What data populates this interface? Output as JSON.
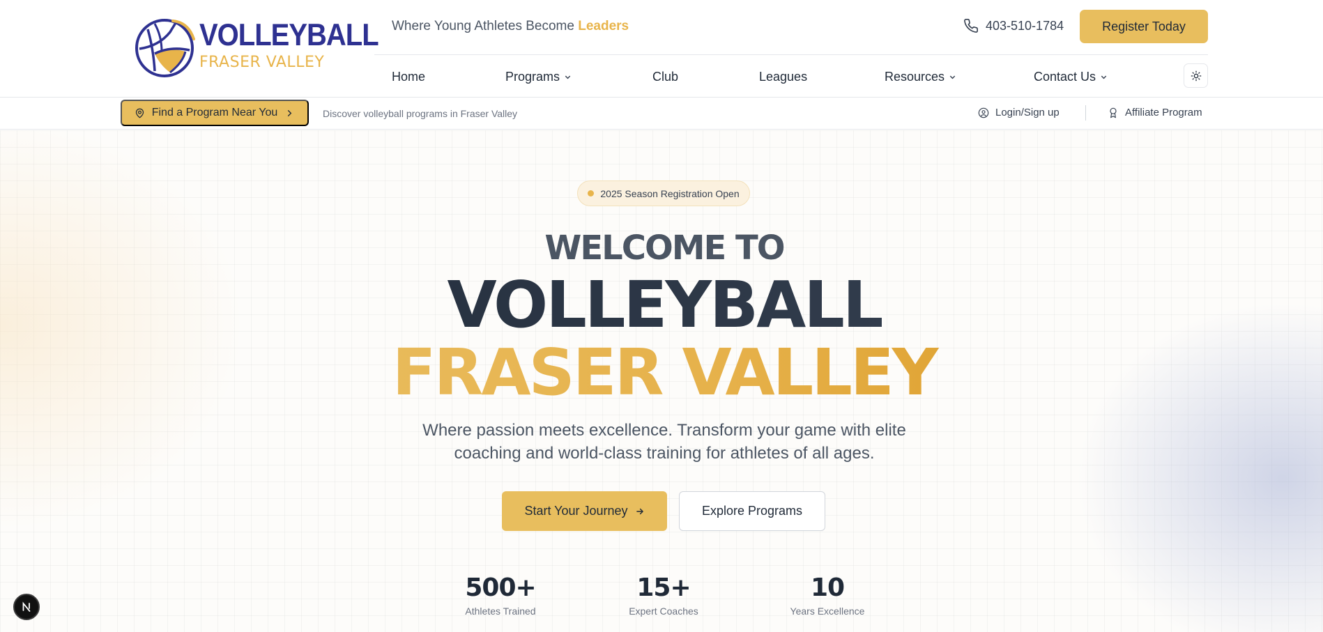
{
  "brand": {
    "line1": "VOLLEYBALL",
    "line2": "FRASER VALLEY",
    "primary_color": "#2e3191",
    "accent_color": "#e8b44a"
  },
  "header": {
    "tagline_prefix": "Where Young Athletes Become ",
    "tagline_accent": "Leaders",
    "phone": "403-510-1784",
    "register_label": "Register Today"
  },
  "nav": {
    "items": [
      {
        "label": "Home",
        "has_dropdown": false
      },
      {
        "label": "Programs",
        "has_dropdown": true
      },
      {
        "label": "Club",
        "has_dropdown": false
      },
      {
        "label": "Leagues",
        "has_dropdown": false
      },
      {
        "label": "Resources",
        "has_dropdown": true
      },
      {
        "label": "Contact Us",
        "has_dropdown": true
      }
    ],
    "theme_toggle_icon": "sun-icon"
  },
  "subbar": {
    "find_label": "Find a Program Near You",
    "description": "Discover volleyball programs in Fraser Valley",
    "login_label": "Login/Sign up",
    "affiliate_label": "Affiliate Program"
  },
  "hero": {
    "badge": "2025 Season Registration Open",
    "welcome": "WELCOME TO",
    "title_main": "VOLLEYBALL",
    "title_accent": "FRASER VALLEY",
    "subtitle": "Where passion meets excellence. Transform your game with elite coaching and world-class training for athletes of all ages.",
    "primary_cta": "Start Your Journey",
    "secondary_cta": "Explore Programs",
    "stats": [
      {
        "value": "500+",
        "label": "Athletes Trained"
      },
      {
        "value": "15+",
        "label": "Expert Coaches"
      },
      {
        "value": "10",
        "label": "Years Excellence"
      }
    ]
  },
  "dev_badge": {
    "letter": "N"
  }
}
